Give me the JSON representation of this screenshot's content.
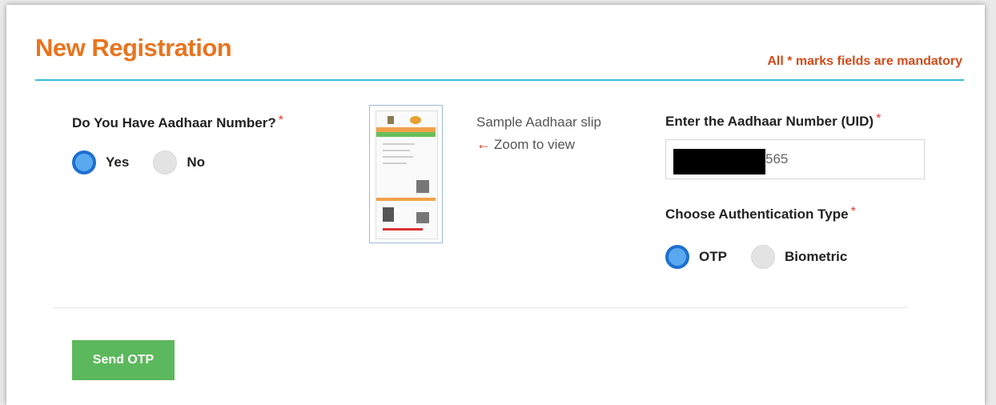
{
  "header": {
    "title": "New Registration",
    "mandatory_prefix": "All",
    "mandatory_star": "*",
    "mandatory_suffix": "marks fields are mandatory"
  },
  "aadhaar_question": {
    "label": "Do You Have Aadhaar Number?",
    "required_mark": "*",
    "options": [
      {
        "label": "Yes",
        "selected": true
      },
      {
        "label": "No",
        "selected": false
      }
    ]
  },
  "sample_slip": {
    "caption": "Sample Aadhaar slip",
    "zoom_text": "Zoom to view"
  },
  "uid": {
    "label": "Enter the Aadhaar Number (UID)",
    "required_mark": "*",
    "visible_value": "565"
  },
  "auth": {
    "label": "Choose Authentication Type",
    "required_mark": "*",
    "options": [
      {
        "label": "OTP",
        "selected": true
      },
      {
        "label": "Biometric",
        "selected": false
      }
    ]
  },
  "actions": {
    "send_otp_label": "Send OTP"
  },
  "colors": {
    "title": "#e8741e",
    "accent_rule": "#33bfd6",
    "radio_selected": "#1e6fd1",
    "button": "#5cb85c",
    "required": "#e33333"
  }
}
